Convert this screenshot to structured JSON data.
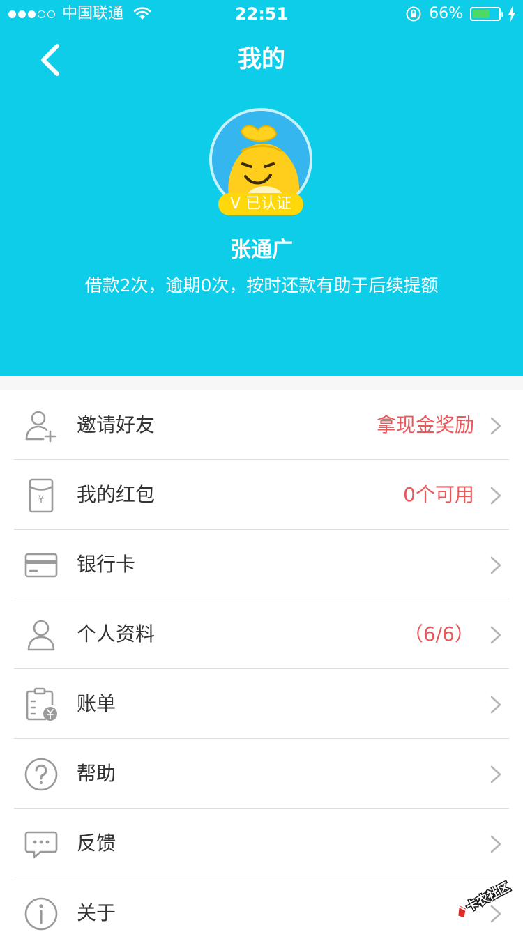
{
  "status_bar": {
    "carrier": "中国联通",
    "time": "22:51",
    "battery_percent": "66%",
    "battery_level": 0.66,
    "signal_bars": 3
  },
  "nav": {
    "title": "我的",
    "back_icon": "chevron-left-icon"
  },
  "profile": {
    "badge": "V 已认证",
    "name": "张通广",
    "subtitle": "借款2次，逾期0次，按时还款有助于后续提额"
  },
  "menu": [
    {
      "label": "邀请好友",
      "extra": "拿现金奖励",
      "icon": "add-user-icon"
    },
    {
      "label": "我的红包",
      "extra": "0个可用",
      "icon": "red-packet-icon"
    },
    {
      "label": "银行卡",
      "extra": "",
      "icon": "bank-card-icon"
    },
    {
      "label": "个人资料",
      "extra": "（6/6）",
      "icon": "user-icon"
    },
    {
      "label": "账单",
      "extra": "",
      "icon": "bill-icon"
    },
    {
      "label": "帮助",
      "extra": "",
      "icon": "help-icon"
    },
    {
      "label": "反馈",
      "extra": "",
      "icon": "feedback-icon"
    },
    {
      "label": "关于",
      "extra": "",
      "icon": "info-icon"
    }
  ],
  "watermark": "卡农社区",
  "colors": {
    "header_bg": "#0ecde9",
    "accent_red": "#e9585a",
    "badge_yellow": "#ffd80a",
    "icon_gray": "#9a9a9a"
  }
}
